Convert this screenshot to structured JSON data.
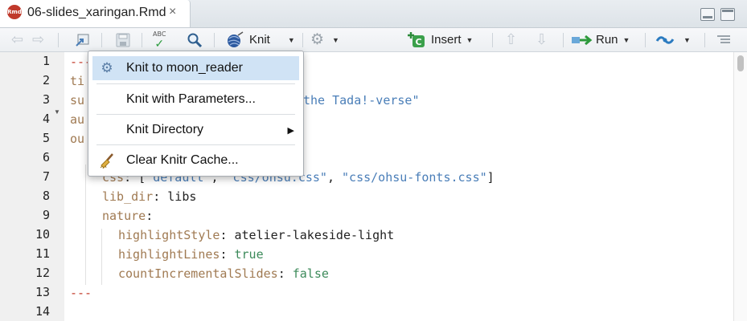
{
  "tab": {
    "icon_text": "Rmd",
    "title": "06-slides_xaringan.Rmd",
    "close": "×"
  },
  "toolbar": {
    "spell_text": "ABC",
    "knit_label": "Knit",
    "insert_label": "Insert",
    "run_label": "Run"
  },
  "lines": [
    {
      "num": "1",
      "text": "---"
    },
    {
      "num": "2",
      "text": "ti"
    },
    {
      "num": "3",
      "text": "su",
      "tail": "the Tada!-verse\""
    },
    {
      "num": "4",
      "text": "au"
    },
    {
      "num": "5",
      "text": "ou"
    },
    {
      "num": "6",
      "text": ""
    },
    {
      "num": "7",
      "key": "css",
      "value": "[\"default\", \"css/ohsu.css\", \"css/ohsu-fonts.css\"]"
    },
    {
      "num": "8",
      "key": "lib_dir",
      "value": "libs"
    },
    {
      "num": "9",
      "key": "nature",
      "value": ""
    },
    {
      "num": "10",
      "key": "highlightStyle",
      "value": "atelier-lakeside-light"
    },
    {
      "num": "11",
      "key": "highlightLines",
      "value": "true"
    },
    {
      "num": "12",
      "key": "countIncrementalSlides",
      "value": "false"
    },
    {
      "num": "13",
      "text": "---"
    },
    {
      "num": "14",
      "text": ""
    }
  ],
  "menu": {
    "items": [
      {
        "label": "Knit to moon_reader",
        "icon": "gear-icon",
        "highlighted": true
      },
      {
        "label": "Knit with Parameters...",
        "icon": ""
      },
      {
        "label": "Knit Directory",
        "icon": "",
        "submenu": true
      },
      {
        "label": "Clear Knitr Cache...",
        "icon": "broom-icon"
      }
    ]
  },
  "colors": {
    "key": "#a07a52",
    "string": "#4a7eb8",
    "bool": "#3c8a5a",
    "yaml_dash": "#c23a2a",
    "highlight": "#d0e3f5"
  }
}
